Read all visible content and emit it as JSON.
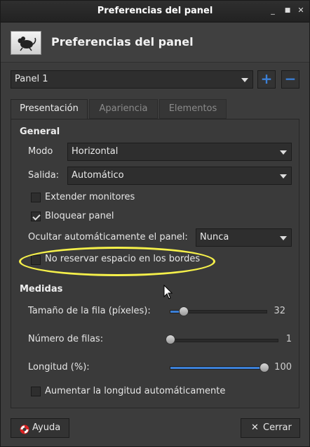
{
  "window": {
    "title": "Preferencias del panel"
  },
  "header": {
    "title": "Preferencias del panel",
    "icon": "mouse-app-icon"
  },
  "panel_select": {
    "value": "Panel 1",
    "add_label": "+",
    "remove_label": "−"
  },
  "tabs": [
    {
      "label": "Presentación",
      "active": true
    },
    {
      "label": "Apariencia",
      "active": false
    },
    {
      "label": "Elementos",
      "active": false
    }
  ],
  "general": {
    "heading": "General",
    "mode_label": "Modo",
    "mode_value": "Horizontal",
    "output_label": "Salida:",
    "output_value": "Automático",
    "extend_monitors": {
      "label": "Extender monitores",
      "checked": false
    },
    "lock_panel": {
      "label": "Bloquear panel",
      "checked": true
    },
    "autohide_label": "Ocultar automáticamente el panel:",
    "autohide_value": "Nunca",
    "no_reserve": {
      "label": "No reservar espacio en los bordes",
      "checked": false
    }
  },
  "measures": {
    "heading": "Medidas",
    "row_size": {
      "label": "Tamaño de la fila (píxeles):",
      "value": "32",
      "fraction": 0.15
    },
    "rows": {
      "label": "Número de filas:",
      "value": "1",
      "fraction": 0.0
    },
    "length": {
      "label": "Longitud (%):",
      "value": "100",
      "fraction": 1.0
    },
    "auto_length": {
      "label": "Aumentar la longitud automáticamente",
      "checked": false
    }
  },
  "footer": {
    "help_label": "Ayuda",
    "close_label": "Cerrar"
  },
  "colors": {
    "accent": "#3b7fd6",
    "highlight": "#f5f04a"
  }
}
